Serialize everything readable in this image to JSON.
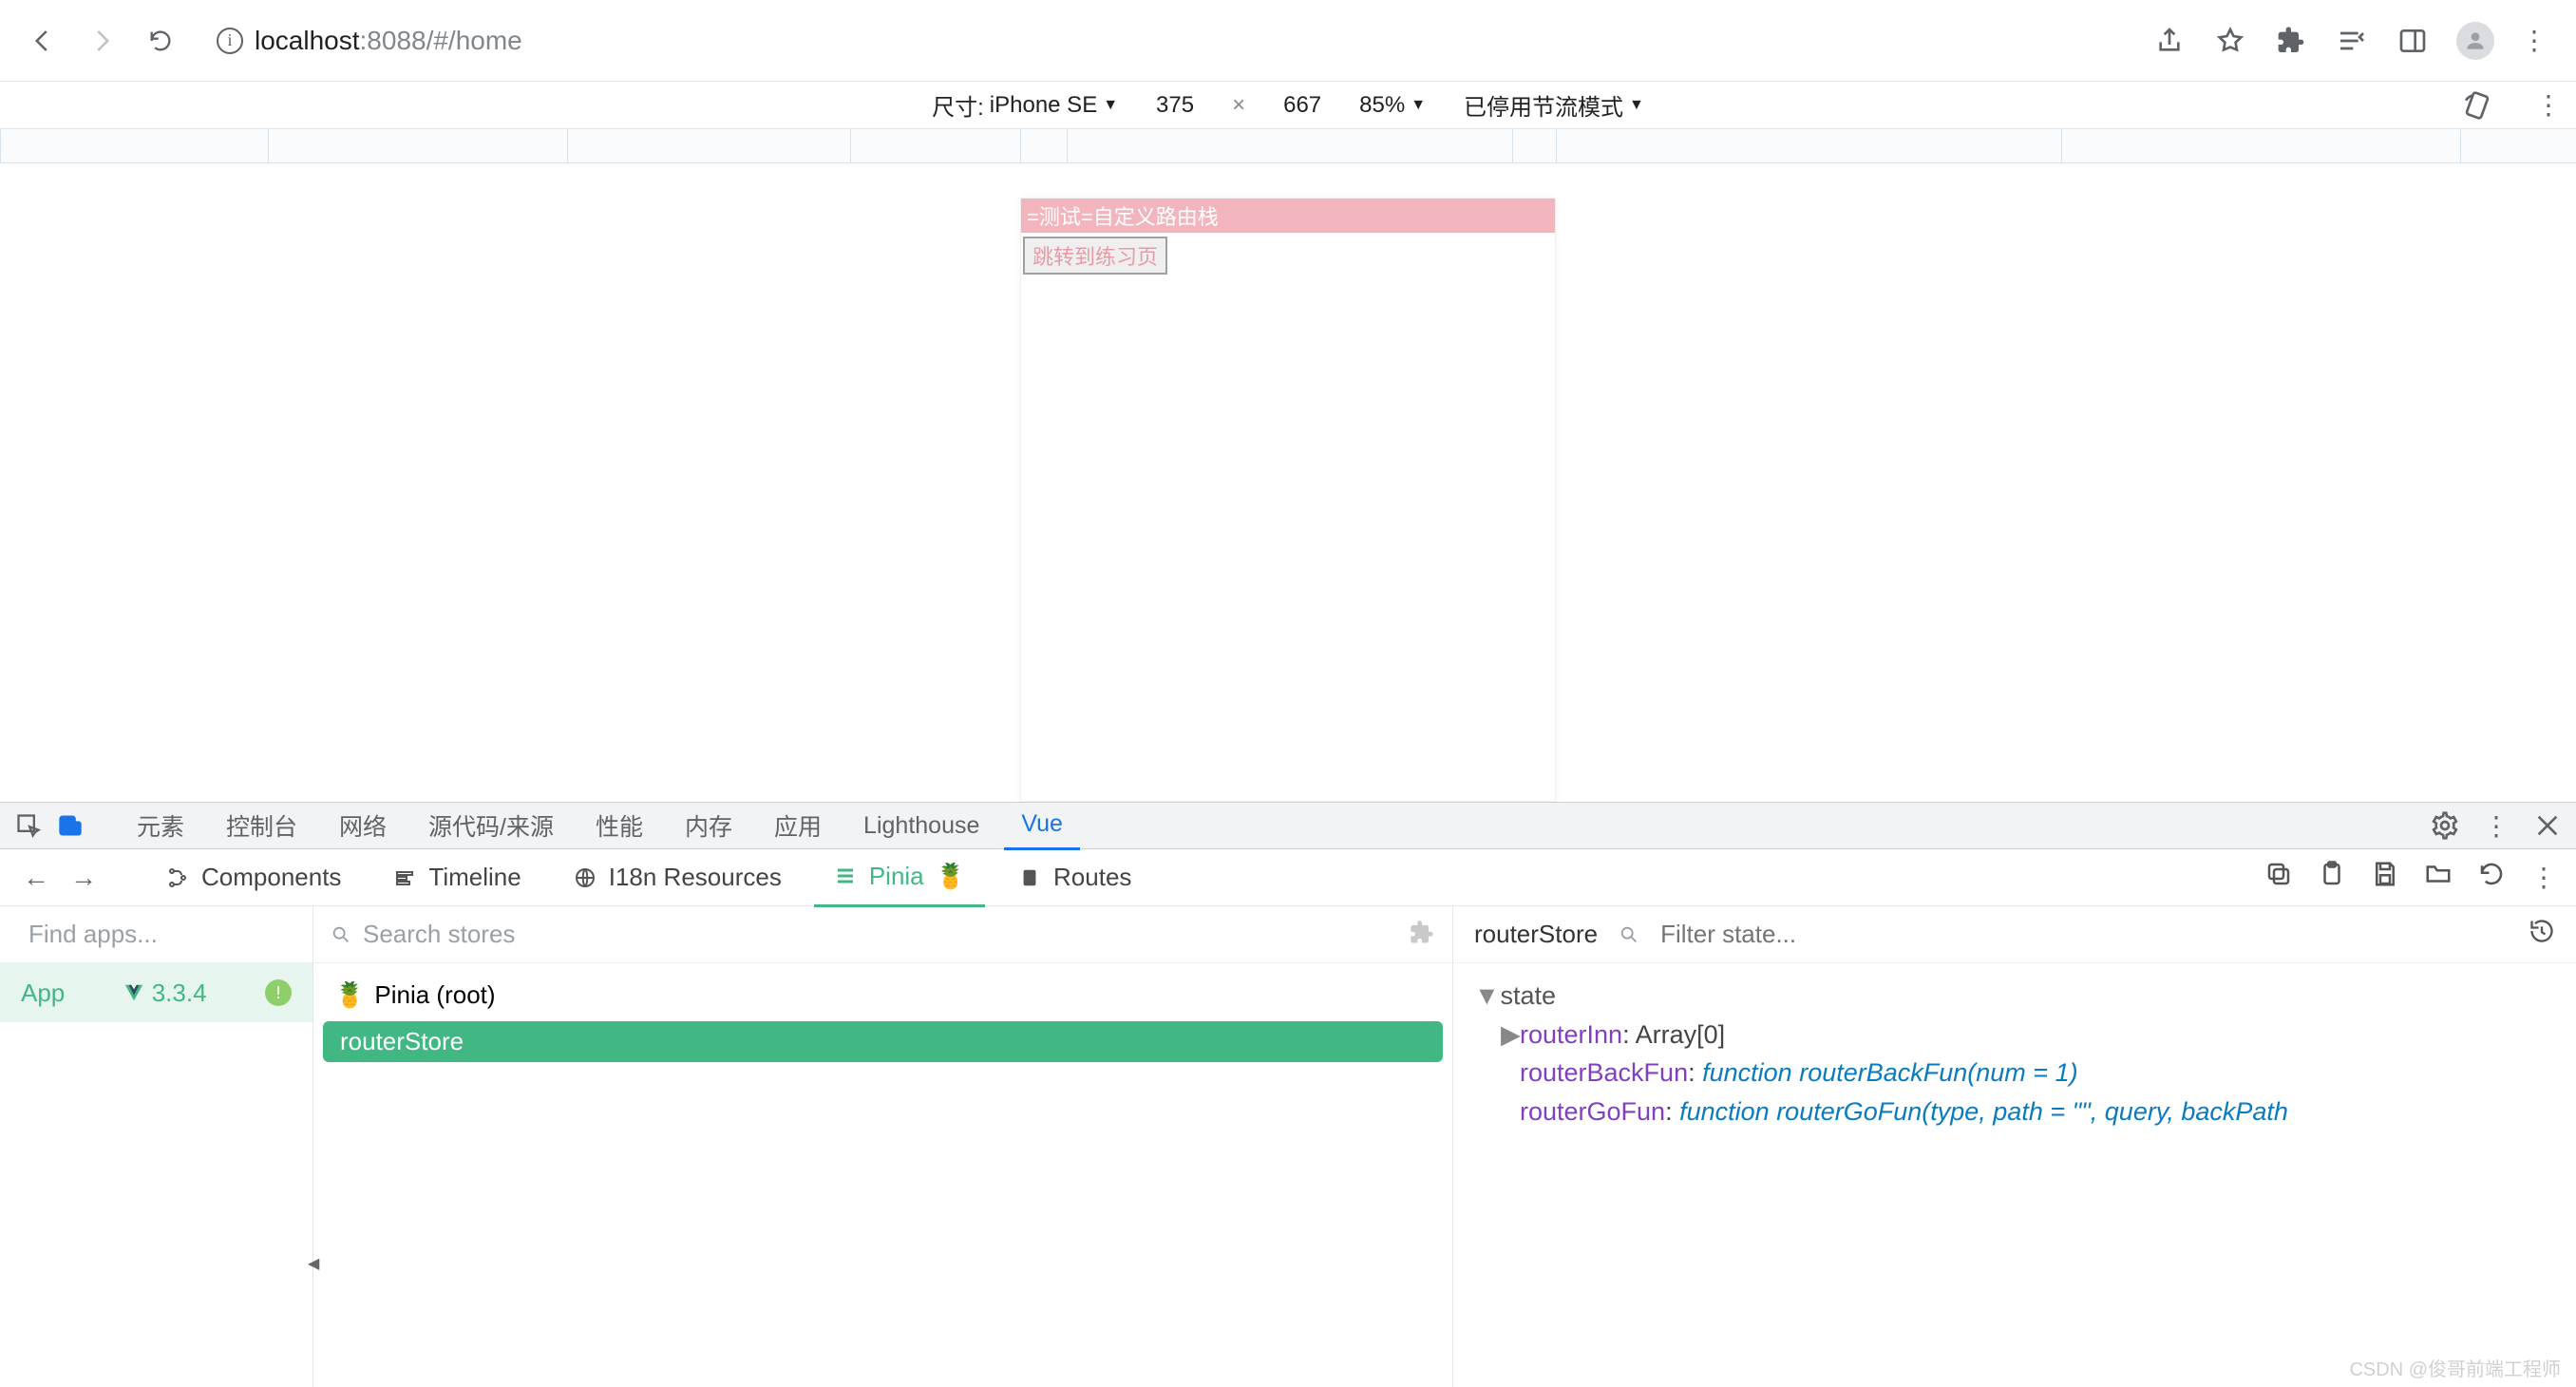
{
  "browser": {
    "url_host": "localhost",
    "url_rest": ":8088/#/home"
  },
  "device_bar": {
    "dim_label": "尺寸:",
    "device": "iPhone SE",
    "width": "375",
    "x": "×",
    "height": "667",
    "zoom": "85%",
    "throttle": "已停用节流模式",
    "more": "⋮"
  },
  "page": {
    "header": "=测试=自定义路由栈",
    "button": "跳转到练习页"
  },
  "devtools_tabs": {
    "elements": "元素",
    "console": "控制台",
    "network": "网络",
    "sources": "源代码/来源",
    "performance": "性能",
    "memory": "内存",
    "application": "应用",
    "lighthouse": "Lighthouse",
    "vue": "Vue"
  },
  "vue_nav": {
    "components": "Components",
    "timeline": "Timeline",
    "i18n": "I18n Resources",
    "pinia": "Pinia",
    "pinia_emoji": "🍍",
    "routes": "Routes"
  },
  "apps": {
    "search_placeholder": "Find apps...",
    "app_name": "App",
    "version": "3.3.4"
  },
  "stores": {
    "search_placeholder": "Search stores",
    "root": "Pinia (root)",
    "root_emoji": "🍍",
    "selected": "routerStore"
  },
  "state_panel": {
    "store_name": "routerStore",
    "filter_placeholder": "Filter state...",
    "section": "state",
    "rows": [
      {
        "expandable": true,
        "key": "routerInn",
        "text_after": ": Array[0]"
      },
      {
        "expandable": false,
        "key": "routerBackFun",
        "fn_kw": "function",
        "sig": "routerBackFun(num = 1)"
      },
      {
        "expandable": false,
        "key": "routerGoFun",
        "fn_kw": "function",
        "sig": "routerGoFun(type, path = \"\", query, backPath"
      }
    ]
  },
  "watermark": "CSDN @俊哥前端工程师"
}
